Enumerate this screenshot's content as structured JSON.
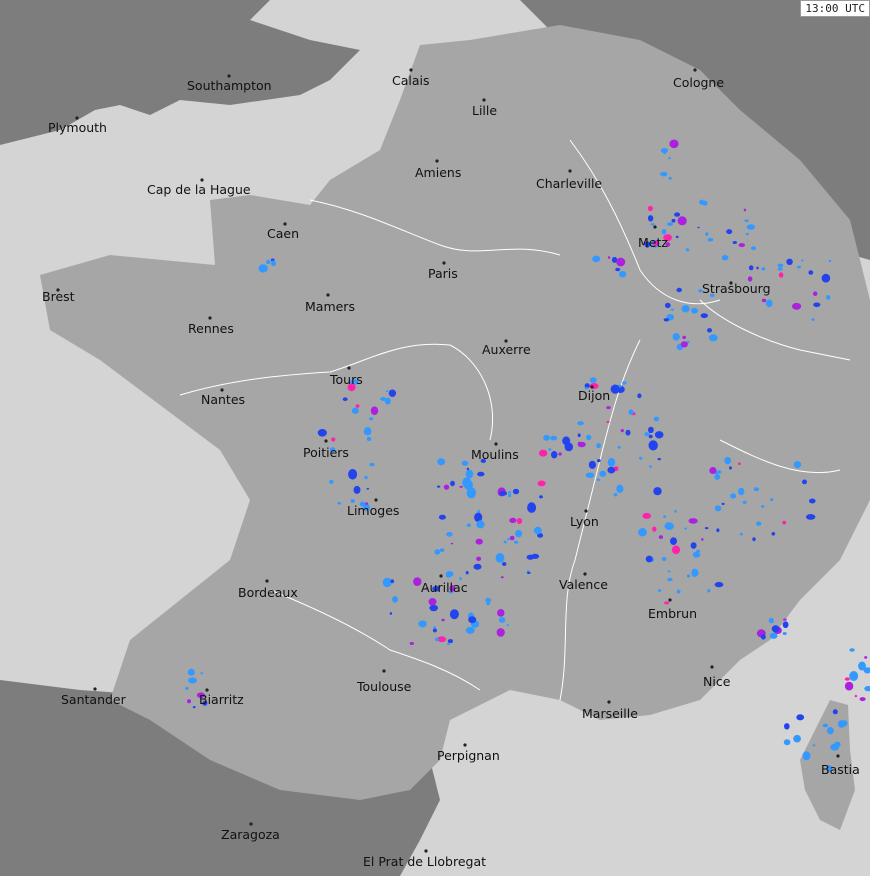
{
  "timestamp": "13:00 UTC",
  "cities": [
    {
      "name": "Calais"
    },
    {
      "name": "Cologne"
    },
    {
      "name": "Southampton"
    },
    {
      "name": "Lille"
    },
    {
      "name": "Plymouth"
    },
    {
      "name": "Amiens"
    },
    {
      "name": "Charleville"
    },
    {
      "name": "Cap de la Hague"
    },
    {
      "name": "Caen"
    },
    {
      "name": "Metz"
    },
    {
      "name": "Paris"
    },
    {
      "name": "Brest"
    },
    {
      "name": "Strasbourg"
    },
    {
      "name": "Mamers"
    },
    {
      "name": "Rennes"
    },
    {
      "name": "Auxerre"
    },
    {
      "name": "Tours"
    },
    {
      "name": "Dijon"
    },
    {
      "name": "Nantes"
    },
    {
      "name": "Poitiers"
    },
    {
      "name": "Moulins"
    },
    {
      "name": "Limoges"
    },
    {
      "name": "Lyon"
    },
    {
      "name": "Valence"
    },
    {
      "name": "Aurillac"
    },
    {
      "name": "Bordeaux"
    },
    {
      "name": "Embrun"
    },
    {
      "name": "Nice"
    },
    {
      "name": "Toulouse"
    },
    {
      "name": "Santander"
    },
    {
      "name": "Biarritz"
    },
    {
      "name": "Marseille"
    },
    {
      "name": "Perpignan"
    },
    {
      "name": "Bastia"
    },
    {
      "name": "Zaragoza"
    },
    {
      "name": "El Prat de Llobregat"
    }
  ],
  "colors": {
    "sea": "#d4d4d4",
    "radar_circle_land": "#a6a6a6",
    "outside_land": "#7d7d7d",
    "rivers_borders": "#ffffff",
    "rain_light": "#3399ff",
    "rain_moderate": "#2244ee",
    "rain_heavy": "#aa22dd",
    "rain_intense": "#ff22aa"
  }
}
